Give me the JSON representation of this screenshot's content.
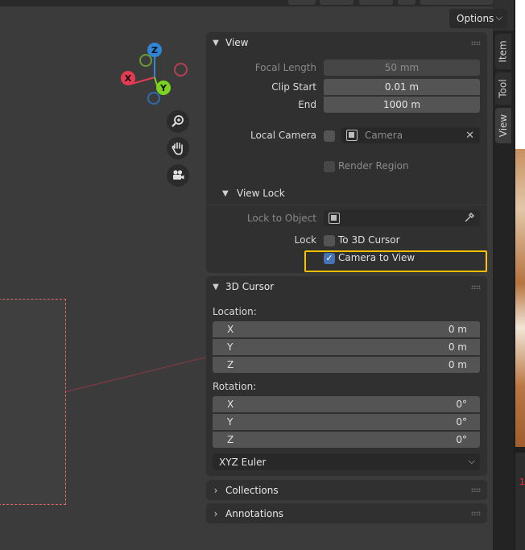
{
  "header": {
    "options_label": "Options"
  },
  "gizmo": {
    "z": "Z",
    "y": "Y",
    "x": "X"
  },
  "colors": {
    "x_axis": "#e53b52",
    "y_axis": "#7bd21f",
    "z_axis": "#2f86d7",
    "highlight": "#ffc000",
    "checkbox_on": "#4772b3"
  },
  "sidebar_tabs": {
    "item": "Item",
    "tool": "Tool",
    "view": "View"
  },
  "view_panel": {
    "title": "View",
    "focal_length_label": "Focal Length",
    "focal_length_value": "50 mm",
    "clip_start_label": "Clip Start",
    "clip_start_value": "0.01 m",
    "end_label": "End",
    "end_value": "1000 m",
    "local_camera_label": "Local Camera",
    "local_camera_value": "Camera",
    "render_region_label": "Render Region"
  },
  "view_lock": {
    "title": "View Lock",
    "lock_to_object_label": "Lock to Object",
    "lock_label": "Lock",
    "to_3d_cursor_label": "To 3D Cursor",
    "camera_to_view_label": "Camera to View"
  },
  "cursor_panel": {
    "title": "3D Cursor",
    "location_label": "Location:",
    "location": [
      {
        "axis": "X",
        "value": "0 m"
      },
      {
        "axis": "Y",
        "value": "0 m"
      },
      {
        "axis": "Z",
        "value": "0 m"
      }
    ],
    "rotation_label": "Rotation:",
    "rotation": [
      {
        "axis": "X",
        "value": "0°"
      },
      {
        "axis": "Y",
        "value": "0°"
      },
      {
        "axis": "Z",
        "value": "0°"
      }
    ],
    "rotation_mode": "XYZ Euler"
  },
  "collections_panel": {
    "title": "Collections"
  },
  "annotations_panel": {
    "title": "Annotations"
  },
  "edge_text": "1"
}
